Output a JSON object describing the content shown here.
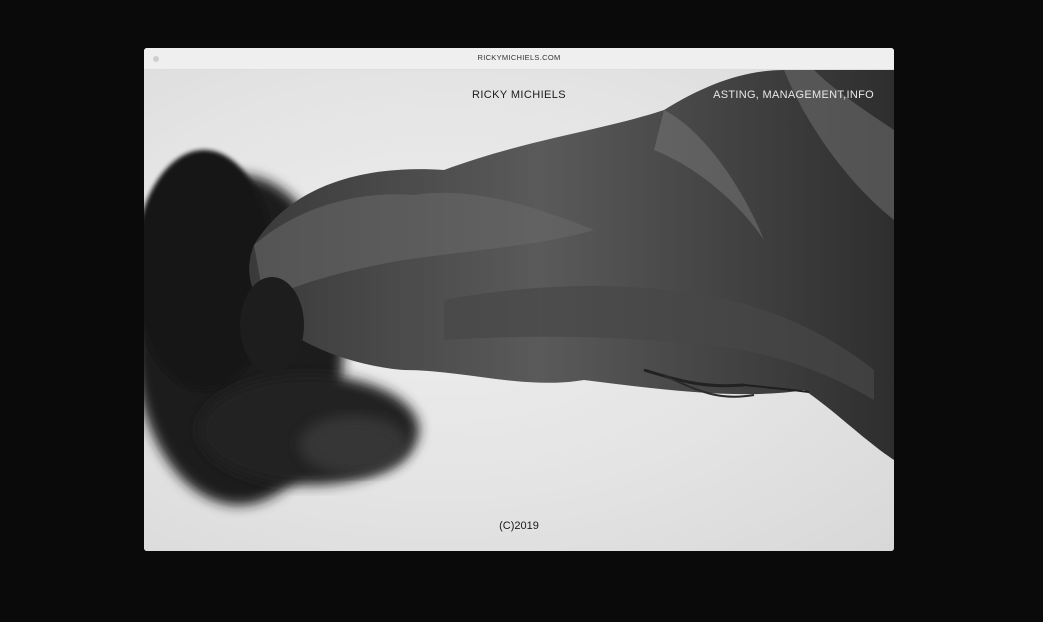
{
  "browser": {
    "url": "RICKYMICHIELS.COM"
  },
  "site": {
    "name": "RICKY MICHIELS",
    "nav": {
      "casting": "ASTING,",
      "management": "MANAGEMENT,",
      "info": "INFO"
    },
    "footer": "(C)2019"
  }
}
